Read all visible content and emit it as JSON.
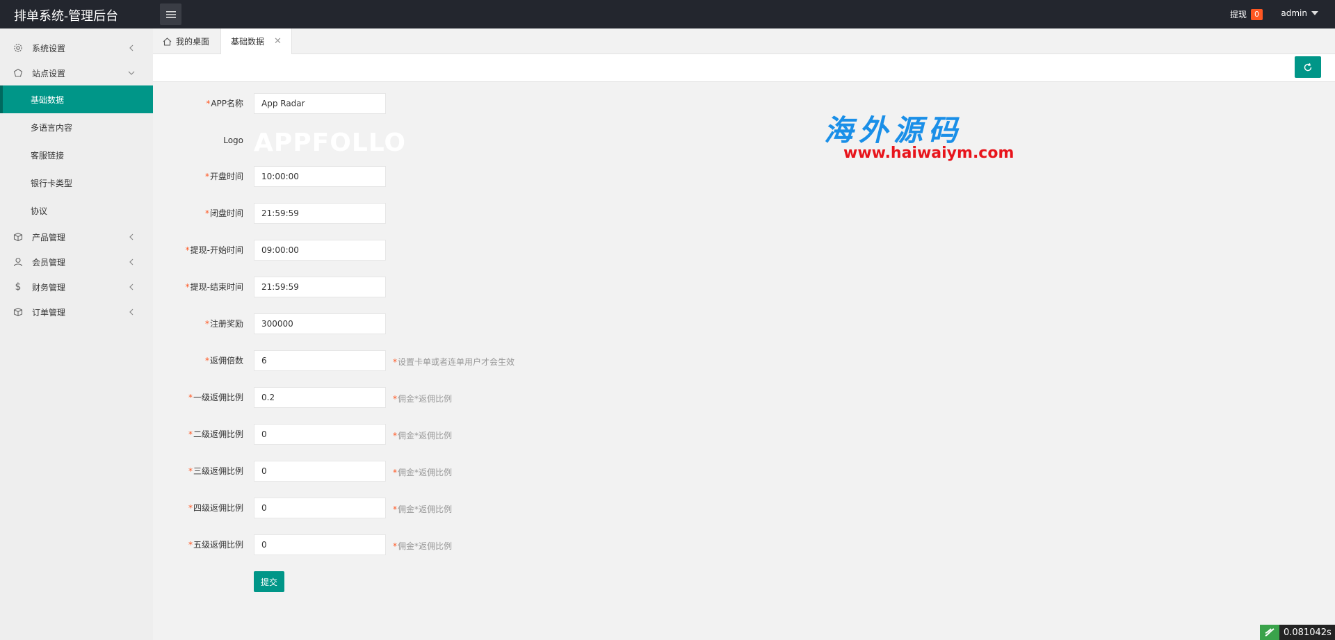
{
  "header": {
    "title": "排单系统-管理后台",
    "withdraw_label": "提现",
    "withdraw_count": "0",
    "user_name": "admin"
  },
  "sidebar": {
    "groups": [
      {
        "label": "系统设置",
        "icon": "gear-icon",
        "expanded": false
      },
      {
        "label": "站点设置",
        "icon": "site-icon",
        "expanded": true,
        "items": [
          {
            "label": "基础数据",
            "active": true
          },
          {
            "label": "多语言内容",
            "active": false
          },
          {
            "label": "客服链接",
            "active": false
          },
          {
            "label": "银行卡类型",
            "active": false
          },
          {
            "label": "协议",
            "active": false
          }
        ]
      },
      {
        "label": "产品管理",
        "icon": "box-icon",
        "expanded": false
      },
      {
        "label": "会员管理",
        "icon": "user-icon",
        "expanded": false
      },
      {
        "label": "财务管理",
        "icon": "dollar-icon",
        "expanded": false
      },
      {
        "label": "订单管理",
        "icon": "box-icon",
        "expanded": false
      }
    ]
  },
  "tabs": {
    "home": "我的桌面",
    "current": "基础数据",
    "close": "✕"
  },
  "form": {
    "required_mark": "*",
    "fields": [
      {
        "label": "APP名称",
        "value": "App Radar",
        "required": true
      },
      {
        "label": "Logo",
        "image_text": "APPFOLLO",
        "required": false
      },
      {
        "label": "开盘时间",
        "value": "10:00:00",
        "required": true
      },
      {
        "label": "闭盘时间",
        "value": "21:59:59",
        "required": true
      },
      {
        "label": "提现-开始时间",
        "value": "09:00:00",
        "required": true
      },
      {
        "label": "提现-结束时间",
        "value": "21:59:59",
        "required": true
      },
      {
        "label": "注册奖励",
        "value": "300000",
        "required": true
      },
      {
        "label": "返佣倍数",
        "value": "6",
        "required": true,
        "hint": "设置卡单或者连单用户才会生效"
      },
      {
        "label": "一级返佣比例",
        "value": "0.2",
        "required": true,
        "hint": "佣金*返佣比例"
      },
      {
        "label": "二级返佣比例",
        "value": "0",
        "required": true,
        "hint": "佣金*返佣比例"
      },
      {
        "label": "三级返佣比例",
        "value": "0",
        "required": true,
        "hint": "佣金*返佣比例"
      },
      {
        "label": "四级返佣比例",
        "value": "0",
        "required": true,
        "hint": "佣金*返佣比例"
      },
      {
        "label": "五级返佣比例",
        "value": "0",
        "required": true,
        "hint": "佣金*返佣比例"
      }
    ],
    "submit_label": "提交"
  },
  "watermark": {
    "cn": "海外源码",
    "url": "www.haiwaiym.com"
  },
  "timer": {
    "value": "0.081042s"
  },
  "colors": {
    "accent": "#009688",
    "header_bg": "#23262e",
    "badge": "#ff5722",
    "required": "#ff5722"
  }
}
